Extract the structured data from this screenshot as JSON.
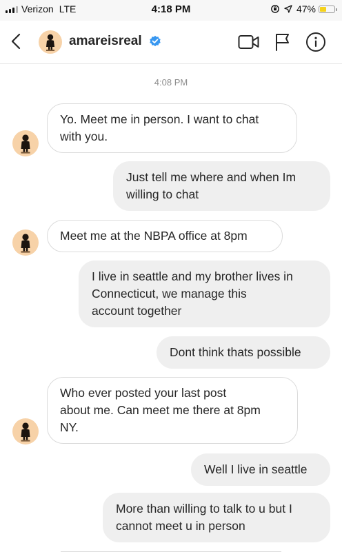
{
  "status_bar": {
    "carrier": "Verizon",
    "network": "LTE",
    "time": "4:18 PM",
    "battery_text": "47%",
    "battery_level": 0.47,
    "battery_color": "#f5d21c"
  },
  "header": {
    "username": "amareisreal",
    "verified_color": "#3897f0",
    "icons": [
      "back-icon",
      "avatar",
      "verified-icon",
      "video-call-icon",
      "flag-icon",
      "info-icon"
    ]
  },
  "thread": {
    "timestamp": "4:08 PM",
    "messages": [
      {
        "direction": "in",
        "lines": [
          "Yo. Meet me in person. I want to chat",
          "with you."
        ]
      },
      {
        "direction": "out",
        "lines": [
          "Just tell me where and when Im",
          "willing to chat"
        ]
      },
      {
        "direction": "in",
        "lines": [
          "Meet me at the NBPA office at 8pm"
        ]
      },
      {
        "direction": "out",
        "lines": [
          "I live in seattle and my brother lives in",
          "Connecticut, we manage this",
          "account together"
        ]
      },
      {
        "direction": "out",
        "lines": [
          "Dont think thats possible"
        ]
      },
      {
        "direction": "in",
        "lines": [
          "Who ever posted your last post",
          "about me. Can meet me there at 8pm",
          "NY."
        ]
      },
      {
        "direction": "out",
        "lines": [
          "Well I live in seattle"
        ]
      },
      {
        "direction": "out",
        "lines": [
          "More than willing to talk to u but I",
          "cannot meet u in person"
        ]
      }
    ]
  }
}
